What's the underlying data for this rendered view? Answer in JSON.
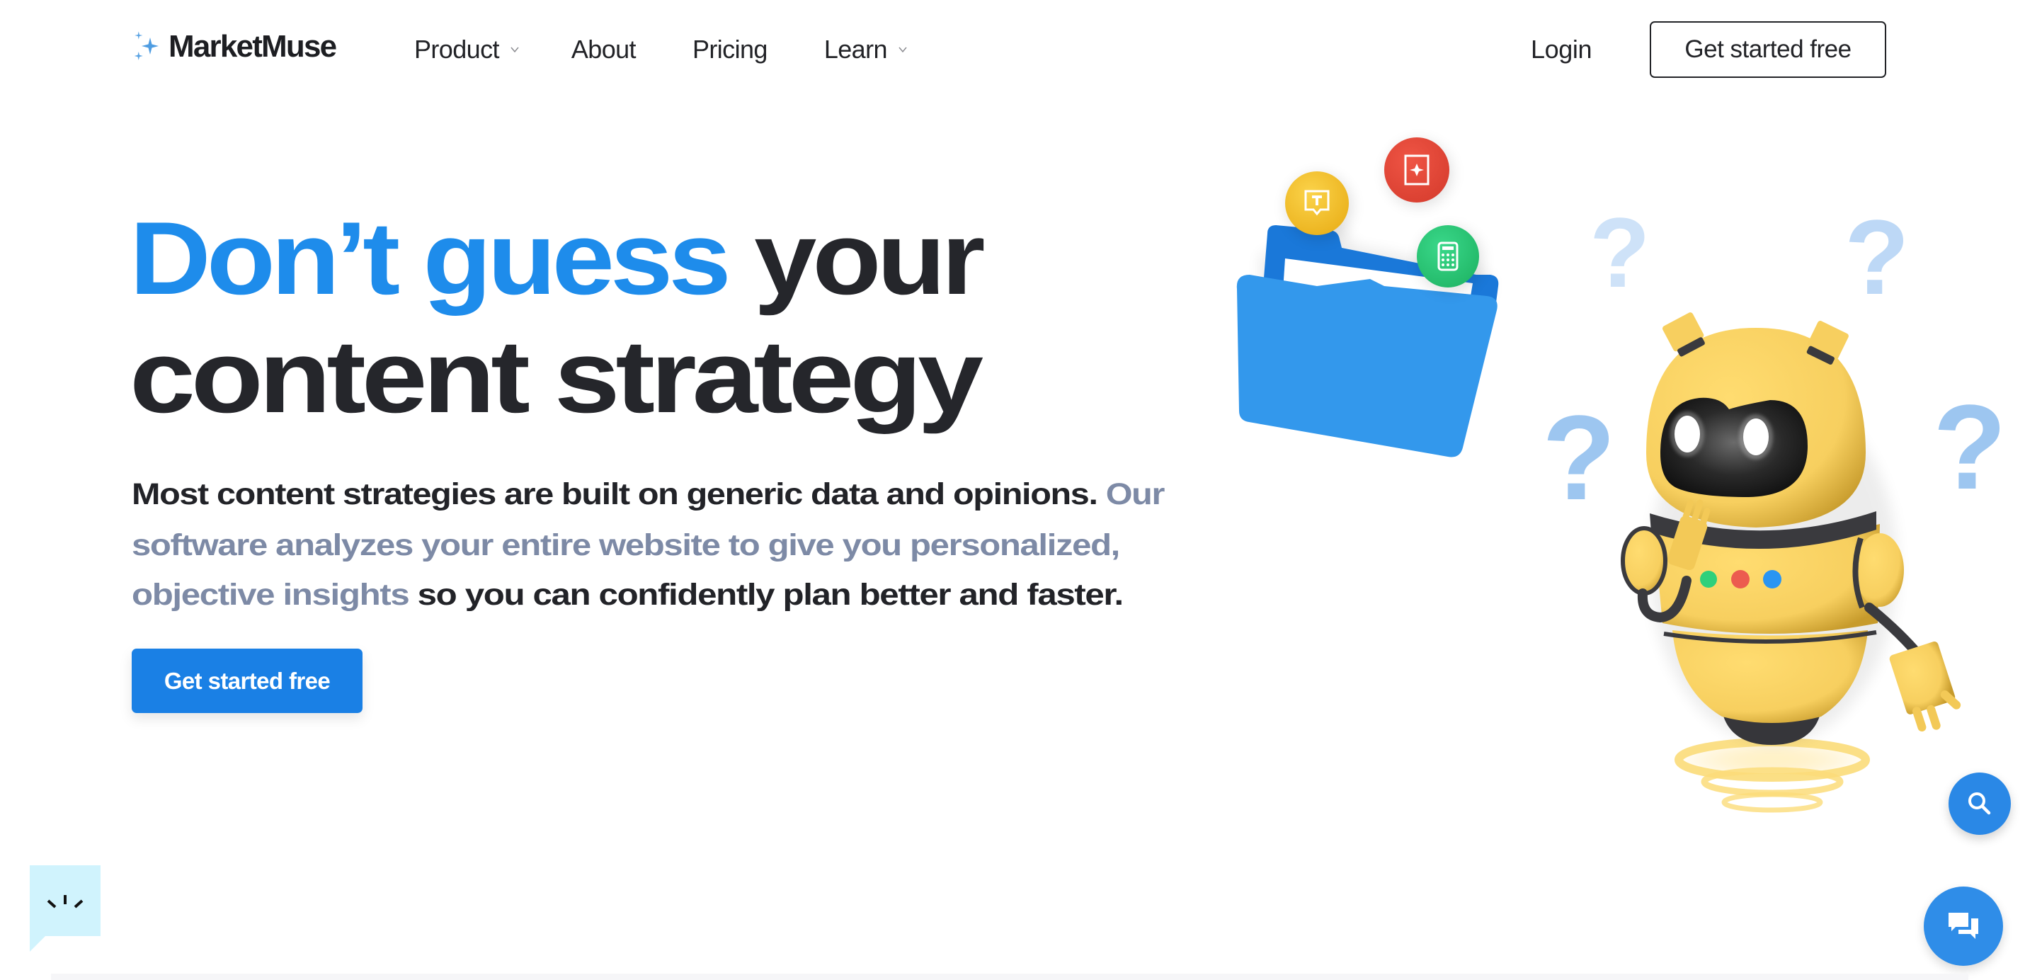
{
  "header": {
    "logo_text": "MarketMuse",
    "logo_icon": "sparkles-icon",
    "nav": [
      {
        "label": "Product",
        "has_dropdown": true
      },
      {
        "label": "About",
        "has_dropdown": false
      },
      {
        "label": "Pricing",
        "has_dropdown": false
      },
      {
        "label": "Learn",
        "has_dropdown": true
      }
    ],
    "login_label": "Login",
    "cta_label": "Get started free"
  },
  "hero": {
    "headline": {
      "highlight": "Don’t guess",
      "rest_line1": " your",
      "line2": "content strategy"
    },
    "lead": {
      "line1_strong": "Most content strategies are built on generic data and opinions.",
      "line1_muted": " Our",
      "line2_muted": "software analyzes your entire website to give you personalized,",
      "line3_muted": "objective insights",
      "line3_strong": " so you can confidently plan better and faster."
    },
    "cta_label": "Get started free"
  },
  "illustration": {
    "folder_badges": [
      "text-bubble-icon",
      "sparkle-card-icon",
      "calculator-icon"
    ],
    "robot": "thinking-robot",
    "question_marks": [
      "?",
      "?",
      "?",
      "?"
    ]
  },
  "widgets": {
    "search_icon": "search-icon",
    "chat_icon": "chat-icon",
    "feedback_icon": "feedback-bubble-icon"
  },
  "colors": {
    "brand_blue": "#1e8ceb",
    "button_blue": "#1a80e5",
    "text_dark": "#222328",
    "text_muted": "#7d8aa6",
    "feedback_bubble": "#d0f3fd"
  }
}
